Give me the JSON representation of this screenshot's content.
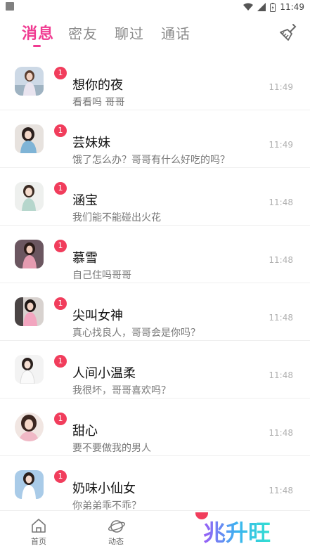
{
  "status": {
    "time": "11:49"
  },
  "tabs": [
    {
      "label": "消息",
      "active": true
    },
    {
      "label": "密友",
      "active": false
    },
    {
      "label": "聊过",
      "active": false
    },
    {
      "label": "通话",
      "active": false
    }
  ],
  "conversations": [
    {
      "name": "想你的夜",
      "preview": "看看吗 哥哥",
      "time": "11:49",
      "badge": "1"
    },
    {
      "name": "芸妹妹",
      "preview": "饿了怎么办？哥哥有什么好吃的吗？",
      "time": "11:49",
      "badge": "1"
    },
    {
      "name": "涵宝",
      "preview": "我们能不能碰出火花",
      "time": "11:48",
      "badge": "1"
    },
    {
      "name": "慕雪",
      "preview": "自己住吗哥哥",
      "time": "11:48",
      "badge": "1"
    },
    {
      "name": "尖叫女神",
      "preview": "真心找良人，哥哥会是你吗？",
      "time": "11:48",
      "badge": "1"
    },
    {
      "name": "人间小温柔",
      "preview": "我很坏，哥哥喜欢吗？",
      "time": "11:48",
      "badge": "1"
    },
    {
      "name": "甜心",
      "preview": "要不要做我的男人",
      "time": "11:48",
      "badge": "1"
    },
    {
      "name": "奶味小仙女",
      "preview": "你弟弟乖不乖？",
      "time": "11:48",
      "badge": "1"
    }
  ],
  "bottom_nav": [
    {
      "label": "首页",
      "icon": "home-icon"
    },
    {
      "label": "动态",
      "icon": "planet-icon"
    }
  ],
  "brand": {
    "text": "兆升旺"
  },
  "colors": {
    "accent": "#f03b91",
    "badge": "#f13d5c"
  }
}
